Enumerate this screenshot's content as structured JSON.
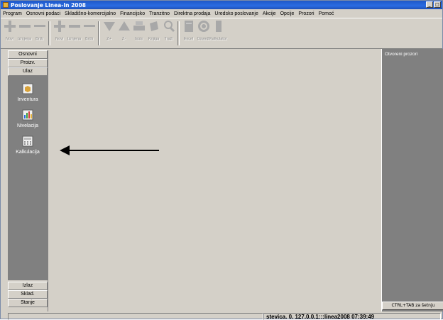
{
  "window": {
    "title": "Poslovanje Linea-In 2008",
    "minimize": "_",
    "maximize": "□"
  },
  "menu": [
    "Program",
    "Osnovni podaci",
    "Skladišno-komercijalno",
    "Financijsko",
    "Tranzitno",
    "Direktna prodaja",
    "Uredsko poslovanje",
    "Akcije",
    "Opcije",
    "Prozori",
    "Pomoć"
  ],
  "toolbar": {
    "buttons": [
      {
        "label": "Novi",
        "icon": "plus-icon"
      },
      {
        "label": "Izmjena",
        "icon": "minus-icon"
      },
      {
        "label": "Briši",
        "icon": "minus-icon"
      },
      {
        "label": "Novi",
        "icon": "plus-icon"
      },
      {
        "label": "Izmjena",
        "icon": "minus-icon"
      },
      {
        "label": "Briši",
        "icon": "minus-icon"
      },
      {
        "label": "Z+",
        "icon": "triangle-down-icon"
      },
      {
        "label": "Z-",
        "icon": "triangle-up-icon"
      },
      {
        "label": "Ispis",
        "icon": "printer-icon"
      },
      {
        "label": "Knjiga",
        "icon": "book-icon"
      },
      {
        "label": "Traži",
        "icon": "search-icon"
      },
      {
        "label": "Excel",
        "icon": "excel-icon"
      },
      {
        "label": "Osvježi",
        "icon": "refresh-icon"
      },
      {
        "label": "Kalkulator",
        "icon": "calculator-icon"
      }
    ]
  },
  "leftpanel": {
    "top_tabs": [
      "Osnovni",
      "Proizv.",
      "Ulaz"
    ],
    "items": [
      {
        "label": "Inventura",
        "icon": "inventory-box-icon"
      },
      {
        "label": "Nivelacija",
        "icon": "bar-chart-icon"
      },
      {
        "label": "Kalkulacija",
        "icon": "calculator-doc-icon"
      }
    ],
    "bottom_tabs": [
      "Izlaz",
      "Sklad.",
      "Stanje"
    ]
  },
  "rightpanel": {
    "title": "Otvoreni prozori",
    "hint": "CTRL+TAB za šetnju"
  },
  "status": {
    "text": "stevica. 0. 127.0.0.1:::linea2008 07:39:49"
  },
  "colors": {
    "title_bar": "#2a6ce3",
    "face": "#d4d0c8",
    "dark_panel": "#808080"
  }
}
